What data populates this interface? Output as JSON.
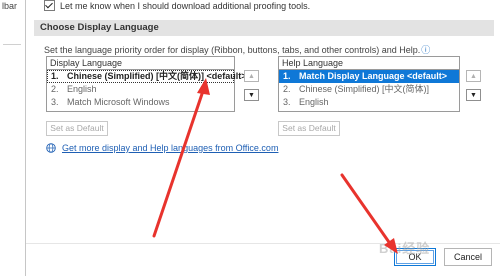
{
  "left_strip": {
    "text": "lbar"
  },
  "top_option": {
    "label": "Let me know when I should download additional proofing tools.",
    "checked": true
  },
  "section": {
    "title": "Choose Display Language",
    "description": "Set the language priority order for display (Ribbon, buttons, tabs, and other controls) and Help.",
    "info_icon": "ⓘ"
  },
  "display_language": {
    "header": "Display Language",
    "items": [
      {
        "num": "1.",
        "label": "Chinese (Simplified) [中文(简体)] <default>"
      },
      {
        "num": "2.",
        "label": "English"
      },
      {
        "num": "3.",
        "label": "Match Microsoft Windows"
      }
    ],
    "up_arrow": "▲",
    "down_arrow": "▼",
    "set_default_label": "Set as Default"
  },
  "help_language": {
    "header": "Help Language",
    "items": [
      {
        "num": "1.",
        "label": "Match Display Language <default>"
      },
      {
        "num": "2.",
        "label": "Chinese (Simplified) [中文(简体)]"
      },
      {
        "num": "3.",
        "label": "English"
      }
    ],
    "up_arrow": "▲",
    "down_arrow": "▼",
    "set_default_label": "Set as Default"
  },
  "link": {
    "text": "Get more display and Help languages from Office.com",
    "icon": "globe-icon"
  },
  "footer": {
    "ok_label": "OK",
    "cancel_label": "Cancel"
  },
  "watermark": {
    "text": "Bai经验"
  },
  "colors": {
    "selection": "#0f78d7",
    "link": "#1e5fb4",
    "annotation_arrow": "#e8332d",
    "section_header_bg": "#e3e3e3"
  }
}
